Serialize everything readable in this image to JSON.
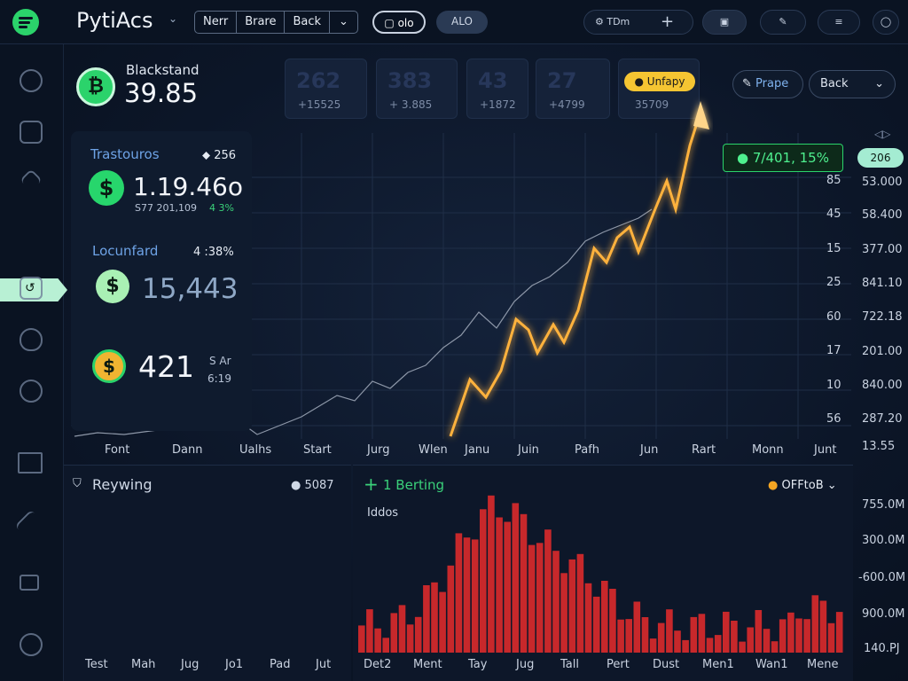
{
  "app": {
    "title": "PytiAcs"
  },
  "topbar": {
    "segments": [
      "Nerr",
      "Brare",
      "Back"
    ],
    "pill1": "olo",
    "pill2": "ALO",
    "btn_tdm": "TDm"
  },
  "ticker": {
    "name": "Blackstand",
    "value": "39.85"
  },
  "stats": [
    {
      "big": "262",
      "small": "+15525"
    },
    {
      "big": "383",
      "small": "+ 3.885"
    },
    {
      "big": "43",
      "small": "+1872"
    },
    {
      "big": "27",
      "small": "+4799"
    }
  ],
  "badge": {
    "label": "Unfapy",
    "sub": "35709"
  },
  "actions": {
    "prape": "Prape",
    "back": "Back"
  },
  "callout": {
    "label": "7/401, 15%"
  },
  "right_tag": "206",
  "left_panel": {
    "block1": {
      "title": "Trastouros",
      "change": "256",
      "value": "1.19.46o",
      "sub": "S77 201,109",
      "pct": "4 3%"
    },
    "block2": {
      "title": "Locunfard",
      "change": "4 :38%",
      "value": "15,443"
    },
    "block3": {
      "value": "421",
      "note1": "S Ar",
      "note2": "6:19"
    }
  },
  "main_chart": {
    "inner_ticks": [
      "85",
      "45",
      "15",
      "25",
      "60",
      "17",
      "10",
      "56"
    ],
    "right_ticks": [
      "53.000",
      "58.400",
      "377.00",
      "841.10",
      "722.18",
      "201.00",
      "840.00",
      "287.20",
      "13.55"
    ],
    "x_labels": [
      "Font",
      "Dann",
      "Ualhs",
      "Start",
      "Jurg",
      "Wlen",
      "Janu",
      "Juin",
      "Pafh",
      "Jun",
      "Rart",
      "Monn",
      "Junt"
    ]
  },
  "bottom_left": {
    "title": "Reywing",
    "count": "5087",
    "x_labels": [
      "Test",
      "Mah",
      "Jug",
      "Jo1",
      "Pad",
      "Jut"
    ]
  },
  "bottom_right": {
    "title": "1 Berting",
    "subtitle": "Iddos",
    "filter": "OFFtoB",
    "right_ticks": [
      "755.0M",
      "300.0M",
      "-600.0M",
      "900.0M",
      "140.PJ"
    ],
    "x_labels": [
      "Det2",
      "Ment",
      "Tay",
      "Jug",
      "Tall",
      "Pert",
      "Dust",
      "Men1",
      "Wan1",
      "Mene"
    ]
  },
  "colors": {
    "accent": "#2bd36b",
    "glow": "#ffb23e",
    "bar": "#c7282b"
  }
}
